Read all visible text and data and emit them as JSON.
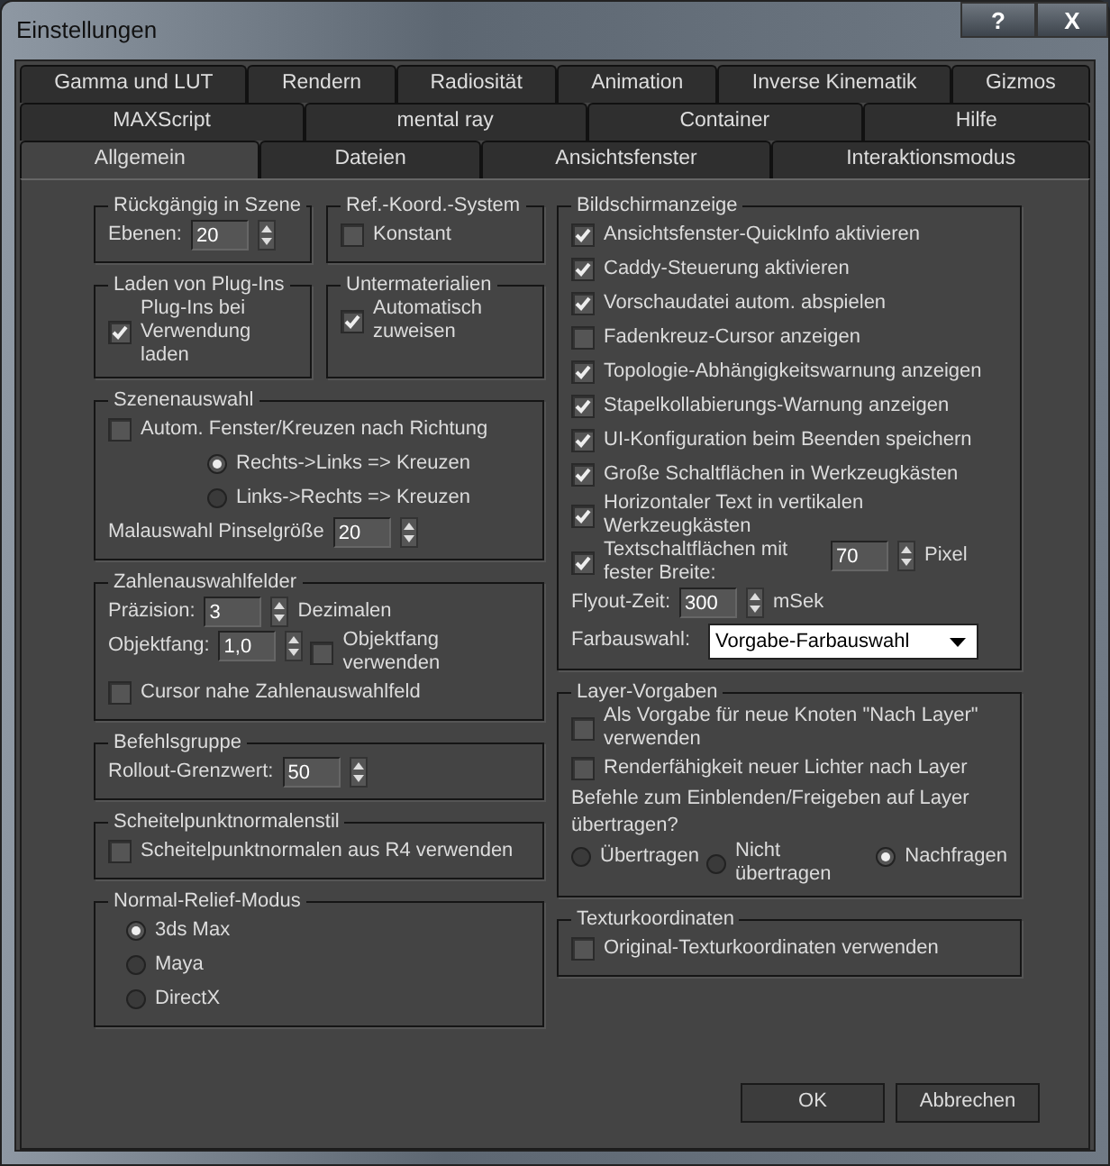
{
  "window": {
    "title": "Einstellungen",
    "help_button": "?",
    "close_button": "X"
  },
  "tab_rows": [
    [
      {
        "label": "Gamma und LUT",
        "selected": false
      },
      {
        "label": "Rendern",
        "selected": false
      },
      {
        "label": "Radiosität",
        "selected": false
      },
      {
        "label": "Animation",
        "selected": false
      },
      {
        "label": "Inverse Kinematik",
        "selected": false
      },
      {
        "label": "Gizmos",
        "selected": false
      }
    ],
    [
      {
        "label": "MAXScript",
        "selected": false
      },
      {
        "label": "mental ray",
        "selected": false
      },
      {
        "label": "Container",
        "selected": false
      },
      {
        "label": "Hilfe",
        "selected": false
      }
    ],
    [
      {
        "label": "Allgemein",
        "selected": true
      },
      {
        "label": "Dateien",
        "selected": false
      },
      {
        "label": "Ansichtsfenster",
        "selected": false
      },
      {
        "label": "Interaktionsmodus",
        "selected": false
      }
    ]
  ],
  "left_column": [
    {
      "kind": "pair",
      "groups": [
        {
          "kind": "group",
          "title": "Rückgängig in Szene",
          "items": [
            {
              "kind": "spinner",
              "label": "Ebenen:",
              "value": "20"
            }
          ]
        },
        {
          "kind": "group",
          "title": "Ref.-Koord.-System",
          "items": [
            {
              "kind": "checkbox",
              "label": "Konstant",
              "checked": false
            }
          ]
        }
      ]
    },
    {
      "kind": "pair",
      "groups": [
        {
          "kind": "group",
          "title": "Laden von Plug-Ins",
          "items": [
            {
              "kind": "checkbox",
              "label": "Plug-Ins bei Verwendung laden",
              "checked": true
            }
          ]
        },
        {
          "kind": "group",
          "title": "Untermaterialien",
          "items": [
            {
              "kind": "checkbox",
              "label": "Automatisch zuweisen",
              "checked": true
            }
          ]
        }
      ]
    },
    {
      "kind": "group",
      "title": "Szenenauswahl",
      "items": [
        {
          "kind": "checkbox",
          "label": "Autom. Fenster/Kreuzen nach Richtung",
          "checked": false
        },
        {
          "kind": "radio",
          "label": "Rechts->Links => Kreuzen",
          "selected": true
        },
        {
          "kind": "radio",
          "label": "Links->Rechts => Kreuzen",
          "selected": false
        },
        {
          "kind": "spinner",
          "label": "Malauswahl Pinselgröße",
          "value": "20"
        }
      ]
    },
    {
      "kind": "group",
      "title": "Zahlenauswahlfelder",
      "items": [
        {
          "kind": "spinner",
          "label": "Präzision:",
          "value": "3",
          "unit": "Dezimalen"
        },
        {
          "kind": "row",
          "items": [
            {
              "kind": "spinner",
              "label": "Objektfang:",
              "value": "1,0"
            },
            {
              "kind": "checkbox",
              "label": "Objektfang verwenden",
              "checked": false
            }
          ]
        },
        {
          "kind": "checkbox",
          "label": "Cursor nahe Zahlenauswahlfeld",
          "checked": false
        }
      ]
    },
    {
      "kind": "group",
      "title": "Befehlsgruppe",
      "items": [
        {
          "kind": "spinner",
          "label": "Rollout-Grenzwert:",
          "value": "50"
        }
      ]
    },
    {
      "kind": "group",
      "title": "Scheitelpunktnormalenstil",
      "items": [
        {
          "kind": "checkbox",
          "label": "Scheitelpunktnormalen aus R4 verwenden",
          "checked": false
        }
      ]
    },
    {
      "kind": "group",
      "title": "Normal-Relief-Modus",
      "items": [
        {
          "kind": "radio",
          "label": "3ds Max",
          "selected": true
        },
        {
          "kind": "radio",
          "label": "Maya",
          "selected": false
        },
        {
          "kind": "radio",
          "label": "DirectX",
          "selected": false
        }
      ]
    }
  ],
  "right_column": [
    {
      "kind": "group",
      "title": "Bildschirmanzeige",
      "items": [
        {
          "kind": "checkbox",
          "label": "Ansichtsfenster-QuickInfo aktivieren",
          "checked": true
        },
        {
          "kind": "checkbox",
          "label": "Caddy-Steuerung aktivieren",
          "checked": true
        },
        {
          "kind": "checkbox",
          "label": "Vorschaudatei autom. abspielen",
          "checked": true
        },
        {
          "kind": "checkbox",
          "label": "Fadenkreuz-Cursor anzeigen",
          "checked": false
        },
        {
          "kind": "checkbox",
          "label": "Topologie-Abhängigkeitswarnung anzeigen",
          "checked": true
        },
        {
          "kind": "checkbox",
          "label": "Stapelkollabierungs-Warnung anzeigen",
          "checked": true
        },
        {
          "kind": "checkbox",
          "label": "UI-Konfiguration beim Beenden speichern",
          "checked": true
        },
        {
          "kind": "checkbox",
          "label": "Große Schaltflächen in Werkzeugkästen",
          "checked": true
        },
        {
          "kind": "checkbox",
          "label": "Horizontaler Text in vertikalen Werkzeugkästen",
          "checked": true
        },
        {
          "kind": "row",
          "items": [
            {
              "kind": "checkbox",
              "label": "Textschaltflächen mit fester Breite:",
              "checked": true
            },
            {
              "kind": "spinner",
              "value": "70",
              "unit": "Pixel"
            }
          ]
        },
        {
          "kind": "spinner",
          "label": "Flyout-Zeit:",
          "value": "300",
          "unit": "mSek"
        },
        {
          "kind": "select",
          "label": "Farbauswahl:",
          "value": "Vorgabe-Farbauswahl"
        }
      ]
    },
    {
      "kind": "group",
      "title": "Layer-Vorgaben",
      "items": [
        {
          "kind": "checkbox",
          "label": "Als Vorgabe für neue Knoten \"Nach Layer\" verwenden",
          "checked": false
        },
        {
          "kind": "checkbox",
          "label": "Renderfähigkeit neuer Lichter nach Layer",
          "checked": false
        },
        {
          "kind": "text",
          "text": "Befehle zum Einblenden/Freigeben auf Layer übertragen?"
        },
        {
          "kind": "row",
          "items": [
            {
              "kind": "radio",
              "label": "Übertragen",
              "selected": false
            },
            {
              "kind": "radio",
              "label": "Nicht übertragen",
              "selected": false
            },
            {
              "kind": "radio",
              "label": "Nachfragen",
              "selected": true
            }
          ]
        }
      ]
    },
    {
      "kind": "group",
      "title": "Texturkoordinaten",
      "items": [
        {
          "kind": "checkbox",
          "label": "Original-Texturkoordinaten verwenden",
          "checked": false
        }
      ]
    }
  ],
  "buttons": [
    "OK",
    "Abbrechen"
  ]
}
